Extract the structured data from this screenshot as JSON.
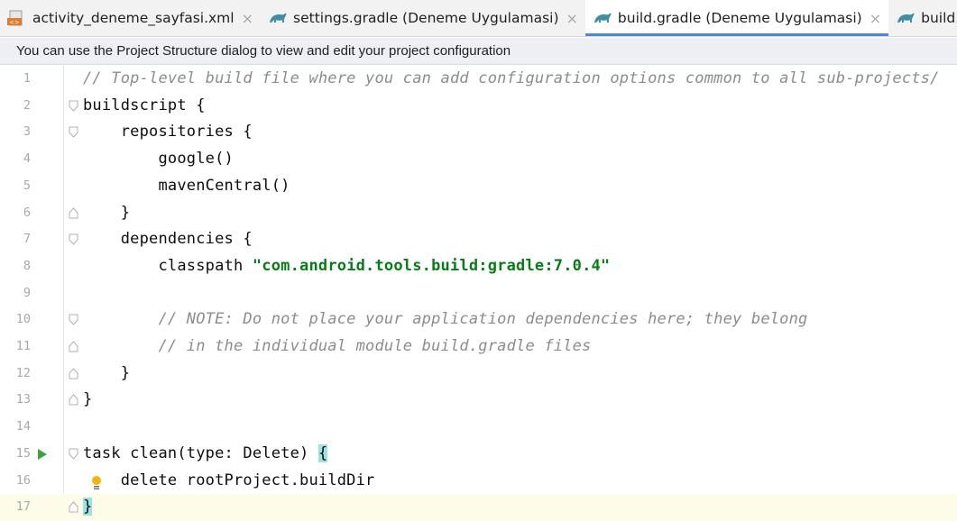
{
  "tabs": [
    {
      "label": "activity_deneme_sayfasi.xml",
      "icon": "xml-file-icon",
      "active": false,
      "closable": true
    },
    {
      "label": "settings.gradle (Deneme Uygulamasi)",
      "icon": "gradle-icon",
      "active": false,
      "closable": true
    },
    {
      "label": "build.gradle (Deneme Uygulamasi)",
      "icon": "gradle-icon",
      "active": true,
      "closable": true
    },
    {
      "label": "build.gradle (:ap",
      "icon": "gradle-icon",
      "active": false,
      "closable": false
    }
  ],
  "tab_close_glyph": "×",
  "notice": "You can use the Project Structure dialog to view and edit your project configuration",
  "lines": [
    {
      "n": "1",
      "indent": "",
      "parts": [
        {
          "t": "// Top-level build file where you can add configuration options common to all sub-projects/",
          "c": "comment"
        }
      ]
    },
    {
      "n": "2",
      "indent": "",
      "parts": [
        {
          "t": "buildscript {",
          "c": "key"
        }
      ]
    },
    {
      "n": "3",
      "indent": "    ",
      "parts": [
        {
          "t": "repositories {",
          "c": "key"
        }
      ]
    },
    {
      "n": "4",
      "indent": "        ",
      "parts": [
        {
          "t": "google()",
          "c": "key"
        }
      ]
    },
    {
      "n": "5",
      "indent": "        ",
      "parts": [
        {
          "t": "mavenCentral()",
          "c": "key"
        }
      ]
    },
    {
      "n": "6",
      "indent": "    ",
      "parts": [
        {
          "t": "}",
          "c": "key"
        }
      ]
    },
    {
      "n": "7",
      "indent": "    ",
      "parts": [
        {
          "t": "dependencies {",
          "c": "key"
        }
      ]
    },
    {
      "n": "8",
      "indent": "        ",
      "parts": [
        {
          "t": "classpath ",
          "c": "key"
        },
        {
          "t": "\"com.android.tools.build:gradle:7.0.4\"",
          "c": "string"
        }
      ]
    },
    {
      "n": "9",
      "indent": "",
      "parts": []
    },
    {
      "n": "10",
      "indent": "        ",
      "parts": [
        {
          "t": "// NOTE: Do not place your application dependencies here; they belong",
          "c": "comment"
        }
      ]
    },
    {
      "n": "11",
      "indent": "        ",
      "parts": [
        {
          "t": "// in the individual module build.gradle files",
          "c": "comment"
        }
      ]
    },
    {
      "n": "12",
      "indent": "    ",
      "parts": [
        {
          "t": "}",
          "c": "key"
        }
      ]
    },
    {
      "n": "13",
      "indent": "",
      "parts": [
        {
          "t": "}",
          "c": "key"
        }
      ]
    },
    {
      "n": "14",
      "indent": "",
      "parts": []
    },
    {
      "n": "15",
      "indent": "",
      "parts": [
        {
          "t": "task clean(type: Delete) ",
          "c": "key"
        },
        {
          "t": "{",
          "c": "brace-hl"
        }
      ]
    },
    {
      "n": "16",
      "indent": "    ",
      "parts": [
        {
          "t": "delete rootProject.buildDir",
          "c": "key"
        }
      ]
    },
    {
      "n": "17",
      "indent": "",
      "parts": [
        {
          "t": "}",
          "c": "brace-hl"
        }
      ]
    }
  ],
  "fold_markers": {
    "2": "open",
    "3": "open",
    "6": "close",
    "7": "open",
    "10": "open",
    "11": "close",
    "12": "close",
    "13": "close",
    "15": "open",
    "17": "close"
  },
  "run_gutter_line": "15",
  "bulb_line": "16",
  "current_line": "17",
  "colors": {
    "active_tab_underline": "#4a89dc",
    "string": "#067d17",
    "comment": "#8c8c8c",
    "brace_highlight": "#9ee3e3",
    "run_icon": "#3fa142",
    "bulb": "#f2b705"
  }
}
